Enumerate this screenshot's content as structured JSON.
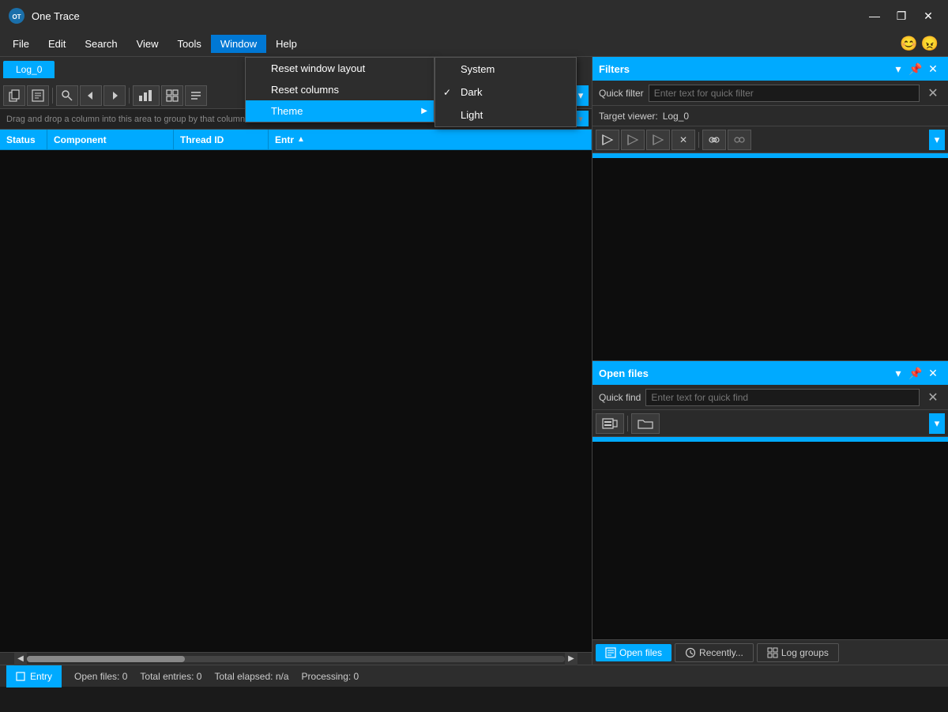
{
  "app": {
    "title": "One Trace",
    "icon_label": "OT"
  },
  "window_controls": {
    "minimize": "—",
    "maximize": "❐",
    "close": "✕"
  },
  "menu_bar": {
    "items": [
      "File",
      "Edit",
      "Search",
      "View",
      "Tools",
      "Window",
      "Help"
    ],
    "active_item": "Window",
    "emoji_happy": "😊",
    "emoji_sad": "😠"
  },
  "tab": {
    "label": "Log_0"
  },
  "toolbar": {
    "dropdown_arrow": "▾"
  },
  "groupby": {
    "text": "Drag and drop a column into this area to group by that column"
  },
  "columns": {
    "headers": [
      "Status",
      "Component",
      "Thread ID",
      "Entry"
    ],
    "sort_col": "Entry",
    "sort_dir": "asc"
  },
  "window_menu": {
    "items": [
      {
        "id": "reset-window",
        "label": "Reset window layout",
        "has_sub": false
      },
      {
        "id": "reset-columns",
        "label": "Reset columns",
        "has_sub": false
      },
      {
        "id": "theme",
        "label": "Theme",
        "has_sub": true,
        "highlighted": true
      }
    ]
  },
  "theme_submenu": {
    "items": [
      {
        "id": "system",
        "label": "System",
        "checked": false
      },
      {
        "id": "dark",
        "label": "Dark",
        "checked": true
      },
      {
        "id": "light",
        "label": "Light",
        "checked": false
      }
    ]
  },
  "filters": {
    "panel_title": "Filters",
    "quick_filter_label": "Quick filter",
    "quick_filter_placeholder": "Enter text for quick filter",
    "target_viewer_label": "Target viewer:",
    "target_viewer_value": "Log_0",
    "filter_buttons": [
      "⊿",
      "⊿",
      "⊿",
      "✕",
      "⊿",
      "⊿"
    ]
  },
  "open_files": {
    "panel_title": "Open files",
    "quick_find_label": "Quick find",
    "quick_find_placeholder": "Enter text for quick find"
  },
  "bottom_tabs": [
    {
      "id": "open-files",
      "label": "Open files",
      "active": true
    },
    {
      "id": "recently",
      "label": "Recently...",
      "active": false
    },
    {
      "id": "log-groups",
      "label": "Log groups",
      "active": false
    }
  ],
  "status_bar": {
    "entry_label": "Entry",
    "open_files": "Open files: 0",
    "total_entries": "Total entries: 0",
    "total_elapsed": "Total elapsed: n/a",
    "processing": "Processing: 0"
  }
}
